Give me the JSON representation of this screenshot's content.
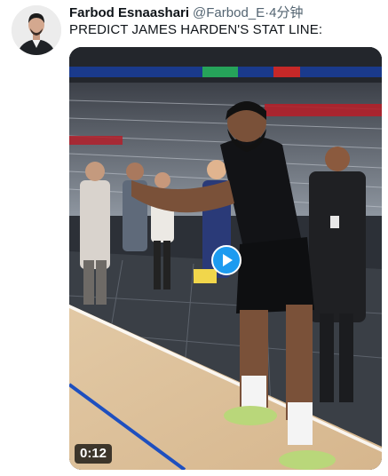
{
  "tweet": {
    "display_name": "Farbod Esnaashari",
    "handle": "@Farbod_E",
    "separator": "·",
    "time": "4分钟",
    "text": "PREDICT JAMES HARDEN'S STAT LINE:"
  },
  "video": {
    "duration": "0:12",
    "play_icon": "play-icon"
  },
  "colors": {
    "accent": "#1d9bf0",
    "text_primary": "#0f1419",
    "text_secondary": "#536471"
  }
}
